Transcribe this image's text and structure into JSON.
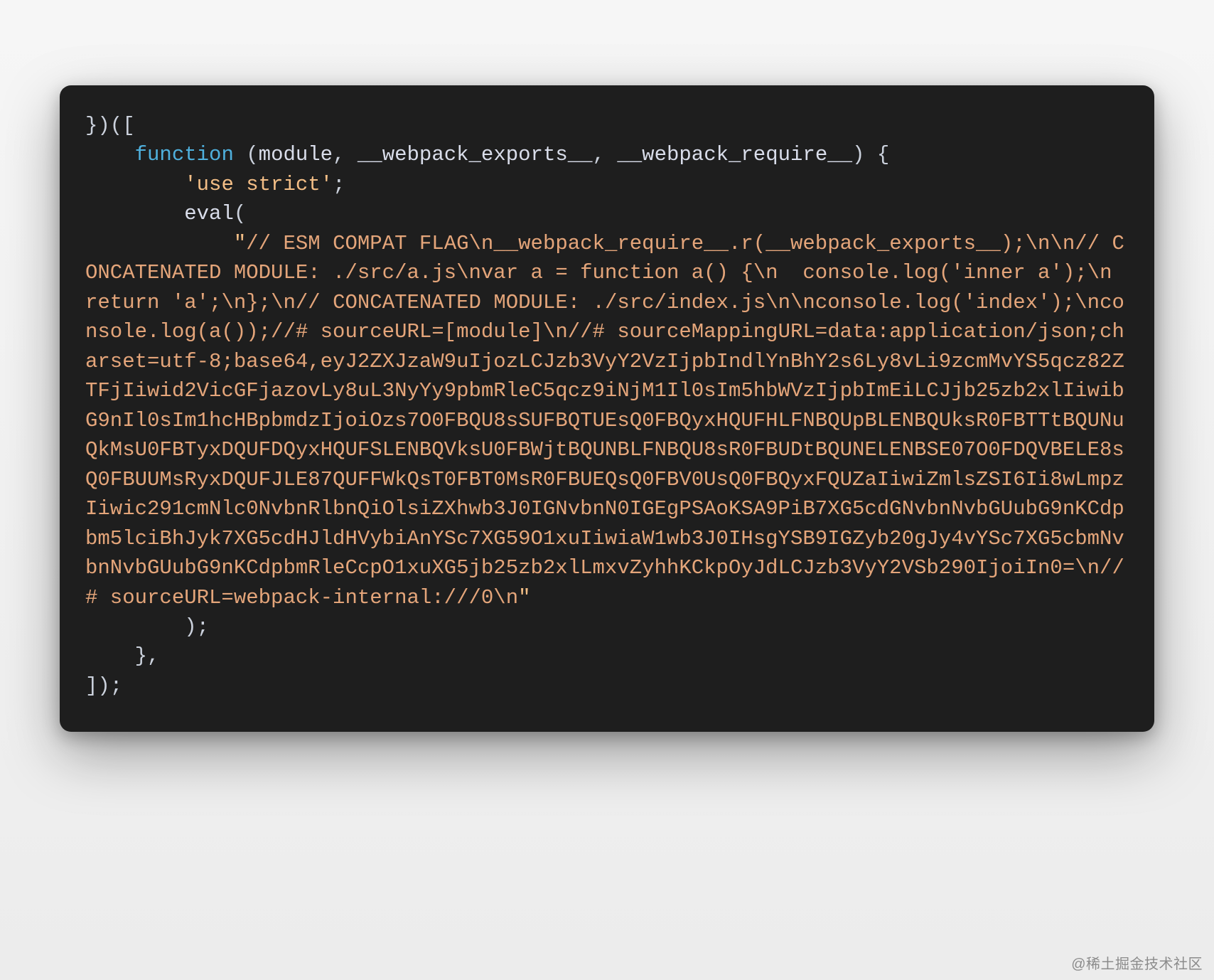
{
  "code": {
    "line_open": "})([",
    "indent1": "    ",
    "kw_function": "function",
    "fn_params_open": " (",
    "param_module": "module",
    "comma_sp": ", ",
    "param_exports": "__webpack_exports__",
    "param_require": "__webpack_require__",
    "fn_params_close": ") {",
    "indent2": "        ",
    "use_strict": "'use strict'",
    "semicolon": ";",
    "eval_call": "eval",
    "eval_open": "(",
    "indent3": "            ",
    "str_open": "\"",
    "str_esm_flag": "// ESM COMPAT FLAG",
    "esc_n": "\\n",
    "str_require_r": "__webpack_require__.r(__webpack_exports__);",
    "str_concat_a_header": "// CONCATENATED MODULE: ./src/a.js",
    "str_var_a": "var a = function a() {",
    "str_pad2": "  ",
    "str_console_inner": "console.log('inner a');",
    "str_return_a": "return 'a';",
    "str_close_brace": "};",
    "str_concat_index_header": "// CONCATENATED MODULE: ./src/index.js",
    "str_console_index": "console.log('index');",
    "str_console_a_call": "console.log(a());",
    "str_srcurl_module": "//# sourceURL=[module]",
    "str_sourcemap_prefix": "//# sourceMappingURL=data:application/json;charset=utf-8;base64,",
    "str_b64": "eyJ2ZXJzaW9uIjozLCJzb3VyY2VzIjpbIndlYnBhY2s6Ly8vLi9zcmMvYS5qcz82ZTFjIiwid2VicGFjazovLy8uL3NyYy9pbmRleC5qcz9iNjM1Il0sIm5hbWVzIjpbImEiLCJjb25zb2xlIiwibG9nIl0sIm1hcHBpbmdzIjoiOzs7O0FBQU8sSUFBQTUEsQ0FBQyxHQUFHLFNBQUpBLENBQUksR0FBTTtBQUNuQkMsU0FBTyxDQUFDQyxHQUFSLENBQVksU0FBWjtBQUNBLFNBQU8sR0FBUDtBQUNELENBSE07O0FDQVBELE8sQ0FBUUMsRyxDQUFJLE87QUFFWkQsT0FBT0MsR0FBUEQsQ0FBV0UsQ0FBQyxFQUZaIiwiZmlsZSI6Ii8wLmpzIiwic291cmNlc0NvbnRlbnQiOlsiZXhwb3J0IGNvbnN0IGEgPSAoKSA9PiB7XG5cdGNvbnNvbGUubG9nKCdpbm5lciBhJyk7XG5cdHJldHVybiAnYSc7XG59O1xuIiwiaW1wb3J0IHsgYSB9IGZyb20gJy4vYSc7XG5cbmNvbnNvbGUubG9nKCdpbmRleCcpO1xuXG5jb25zb2xlLmxvZyhhKCkpOyJdLCJzb3VyY2VSb290IjoiIn0=",
    "str_srcurl_internal": "//# sourceURL=webpack-internal:///0",
    "str_close": "\"",
    "eval_close_line": "        );",
    "fn_close_line": "    },",
    "arr_close_line": "]);"
  },
  "watermark": "@稀土掘金技术社区"
}
